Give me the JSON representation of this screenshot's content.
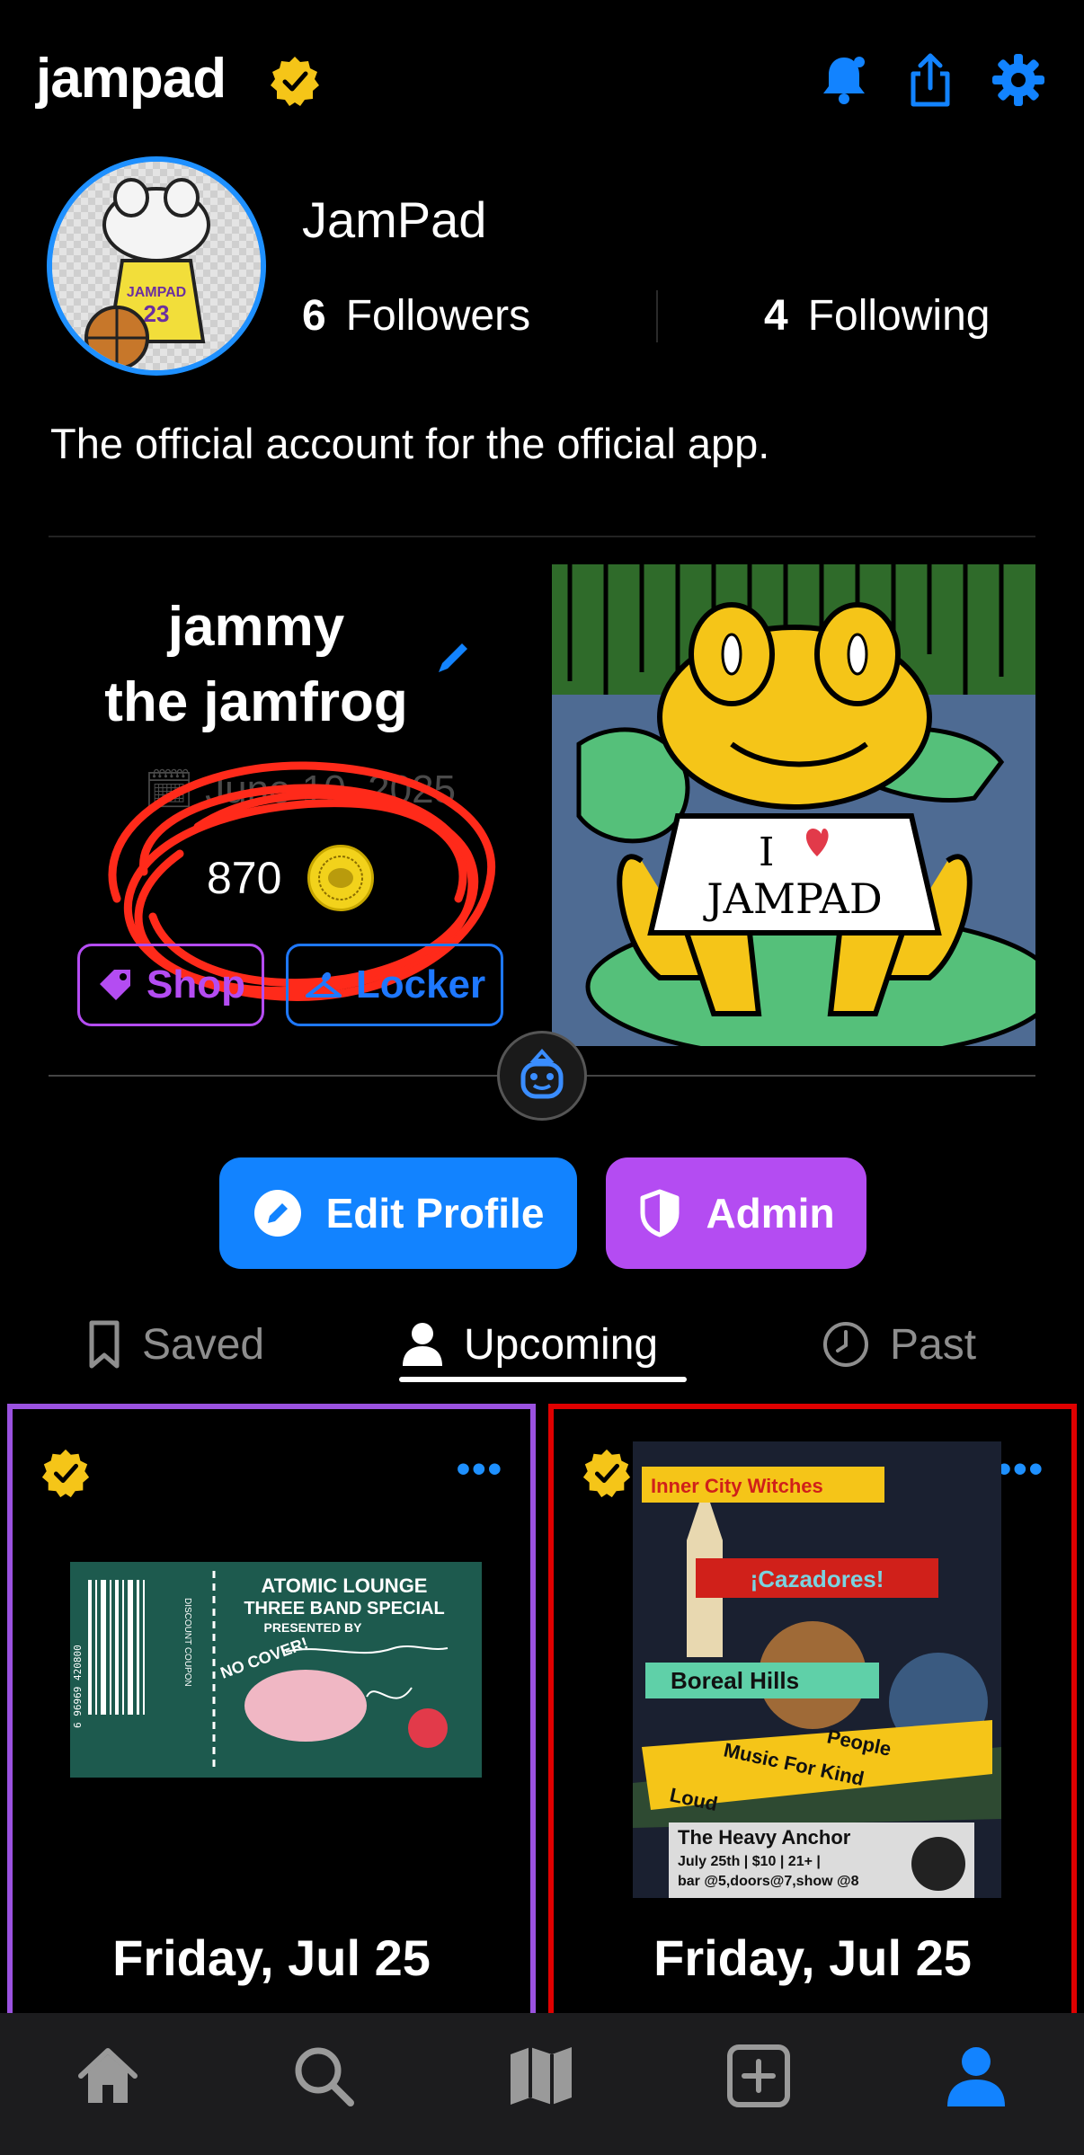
{
  "header": {
    "app_title": "jampad",
    "icons": [
      "bell-icon",
      "share-icon",
      "gear-icon"
    ]
  },
  "profile": {
    "display_name": "JamPad",
    "followers_count": "6",
    "followers_label": "Followers",
    "following_count": "4",
    "following_label": "Following",
    "bio": "The official account for the official app."
  },
  "pet": {
    "name_line1": "jammy",
    "name_line2": "the jamfrog",
    "date": "June 10, 2025",
    "coins": "870",
    "shop_label": "Shop",
    "locker_label": "Locker",
    "art_text_i": "I",
    "art_text_jampad": "JAMPAD"
  },
  "actions": {
    "edit_profile_label": "Edit Profile",
    "admin_label": "Admin"
  },
  "tabs": [
    {
      "label": "Saved"
    },
    {
      "label": "Upcoming"
    },
    {
      "label": "Past"
    }
  ],
  "cards": [
    {
      "more": "•••",
      "flyer": {
        "line1": "ATOMIC LOUNGE",
        "line2": "THREE BAND SPECIAL",
        "line3": "PRESENTED BY",
        "no_cover": "NO COVER!",
        "discount": "DISCOUNT COUPON",
        "barcode_digits": "6 96969 420800"
      },
      "date": "Friday, Jul 25"
    },
    {
      "more": "•••",
      "flyer": {
        "band1": "Inner City Witches",
        "band2": "¡Cazadores!",
        "band3": "Boreal Hills",
        "band4a": "Loud",
        "band4b": "Music For Kind",
        "band4c": "People",
        "venue": "The Heavy Anchor",
        "details": "July 25th | $10 | 21+ |",
        "times": "bar @5,doors@7,show @8"
      },
      "date": "Friday, Jul 25"
    }
  ],
  "bottom_nav": [
    "home-icon",
    "search-icon",
    "map-icon",
    "add-icon",
    "profile-icon"
  ],
  "colors": {
    "accent_blue": "#1283ff",
    "admin_purple": "#b44cf2",
    "verified_yellow": "#f5c518",
    "scribble_red": "#ff2a1a"
  }
}
